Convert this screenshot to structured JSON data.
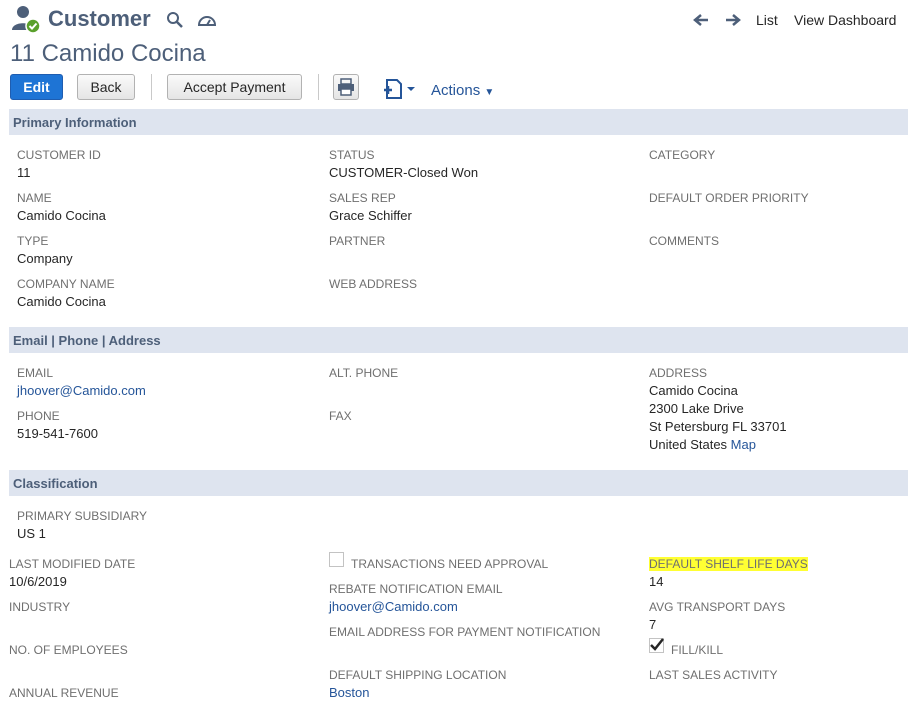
{
  "header": {
    "record_type": "Customer",
    "record_title": "11 Camido Cocina",
    "nav": {
      "list": "List",
      "view_dashboard": "View Dashboard"
    }
  },
  "toolbar": {
    "edit": "Edit",
    "back": "Back",
    "accept_payment": "Accept Payment",
    "actions": "Actions"
  },
  "sections": {
    "primary": "Primary Information",
    "contact": "Email | Phone | Address",
    "classification": "Classification"
  },
  "primary": {
    "customer_id_label": "CUSTOMER ID",
    "customer_id": "11",
    "name_label": "NAME",
    "name": "Camido Cocina",
    "type_label": "TYPE",
    "type": "Company",
    "company_name_label": "COMPANY NAME",
    "company_name": "Camido Cocina",
    "status_label": "STATUS",
    "status": "CUSTOMER-Closed Won",
    "sales_rep_label": "SALES REP",
    "sales_rep": "Grace Schiffer",
    "partner_label": "PARTNER",
    "web_address_label": "WEB ADDRESS",
    "category_label": "CATEGORY",
    "default_order_priority_label": "DEFAULT ORDER PRIORITY",
    "comments_label": "COMMENTS"
  },
  "contact": {
    "email_label": "EMAIL",
    "email": "jhoover@Camido.com",
    "phone_label": "PHONE",
    "phone": "519-541-7600",
    "alt_phone_label": "ALT. PHONE",
    "fax_label": "FAX",
    "address_label": "ADDRESS",
    "address_line1": "Camido Cocina",
    "address_line2": "2300 Lake Drive",
    "address_line3": "St Petersburg FL 33701",
    "address_line4": "United States",
    "map_link": "Map"
  },
  "classification": {
    "primary_subsidiary_label": "PRIMARY SUBSIDIARY",
    "primary_subsidiary": "US 1",
    "last_modified_label": "LAST MODIFIED DATE",
    "last_modified": "10/6/2019",
    "industry_label": "INDUSTRY",
    "employees_label": "NO. OF EMPLOYEES",
    "annual_revenue_label": "ANNUAL REVENUE",
    "transactions_approval_label": "TRANSACTIONS NEED APPROVAL",
    "transactions_approval_checked": false,
    "rebate_email_label": "REBATE NOTIFICATION EMAIL",
    "rebate_email": "jhoover@Camido.com",
    "payment_email_label": "EMAIL ADDRESS FOR PAYMENT NOTIFICATION",
    "shipping_location_label": "DEFAULT SHIPPING LOCATION",
    "shipping_location": "Boston",
    "shelf_life_label": "DEFAULT SHELF LIFE DAYS",
    "shelf_life": "14",
    "avg_transport_label": "AVG TRANSPORT DAYS",
    "avg_transport": "7",
    "fill_kill_label": "FILL/KILL",
    "fill_kill_checked": true,
    "last_sales_activity_label": "LAST SALES ACTIVITY"
  },
  "colors": {
    "accent": "#1e74d5",
    "section_bar": "#dee4ef",
    "title": "#4d5f79",
    "link": "#255599",
    "highlight": "#ffff33"
  }
}
